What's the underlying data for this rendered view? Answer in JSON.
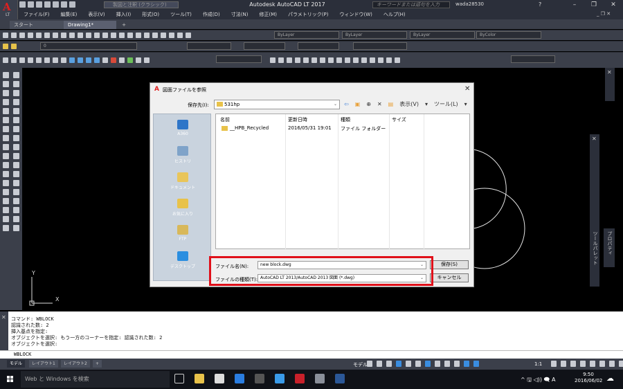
{
  "app": {
    "window_title": "Autodesk AutoCAD LT 2017",
    "app_button_letter": "A",
    "app_button_sub": "LT",
    "qat_dropdown": "製図と注釈 (クラシック)",
    "search_placeholder": "キーワードまたは語句を入力",
    "username": "wada28530",
    "help_label": "?",
    "win_minimize": "–",
    "win_restore": "❐",
    "win_close": "✕"
  },
  "menu": [
    "ファイル(F)",
    "編集(E)",
    "表示(V)",
    "挿入(I)",
    "形式(O)",
    "ツール(T)",
    "作成(D)",
    "寸法(N)",
    "修正(M)",
    "パラメトリック(P)",
    "ウィンドウ(W)",
    "ヘルプ(H)"
  ],
  "mdi_controls": "_ ❐ ✕",
  "doc_tabs": {
    "start": "スタート",
    "drawing": "Drawing1*",
    "plus": "+"
  },
  "toolbars": {
    "layer_combo": "ByLayer",
    "linetype_combo": "ByLayer",
    "lineweight_combo": "ByLayer",
    "color_combo": "ByColor",
    "layer_name": "0"
  },
  "right_palette": {
    "label1": "ツールパレット",
    "label2": "プロパティ"
  },
  "dialog": {
    "title": "図面ファイルを参照",
    "close": "✕",
    "save_in_label": "保存先(I):",
    "save_in_value": "531hp",
    "view_menu": "表示(V)",
    "tools_menu": "ツール(L)",
    "places": [
      {
        "label": "A360",
        "color": "#2f76c8"
      },
      {
        "label": "ヒストリ",
        "color": "#7fa3c9"
      },
      {
        "label": "ドキュメント",
        "color": "#e9c55a"
      },
      {
        "label": "お気に入り",
        "color": "#e8c24a"
      },
      {
        "label": "FTP",
        "color": "#d8b85a"
      },
      {
        "label": "デスクトップ",
        "color": "#2a8ee0"
      }
    ],
    "columns": {
      "name": "名前",
      "date": "更新日時",
      "type": "種類",
      "size": "サイズ"
    },
    "rows": [
      {
        "name": "__HPB_Recycled",
        "date": "2016/05/31 19:01",
        "type": "ファイル フォルダー",
        "size": ""
      }
    ],
    "filename_label": "ファイル名(N):",
    "filename_value": "new block.dwg",
    "filetype_label": "ファイルの種類(T):",
    "filetype_value": "AutoCAD LT 2013/AutoCAD 2013 図面 (*.dwg)",
    "save_button": "保存(S)",
    "cancel_button": "キャンセル"
  },
  "command_history": [
    "コマンド: WBLOCK",
    "認識された数: 2",
    "挿入基点を指定:",
    "オブジェクトを選択: もう一方のコーナーを指定: 認識された数: 2",
    "オブジェクトを選択:"
  ],
  "command_input": "WBLOCK",
  "layout_tabs": [
    "モデル",
    "レイアウト1",
    "レイアウト2",
    "+"
  ],
  "status": {
    "model": "モデル",
    "scale": "1:1"
  },
  "taskbar": {
    "search": "Web と Windows を検索",
    "tray": "^ 🖫 ◁)) 🗨 A",
    "time": "9:50",
    "date": "2016/06/02"
  },
  "ucs": {
    "x": "X",
    "y": "Y"
  }
}
